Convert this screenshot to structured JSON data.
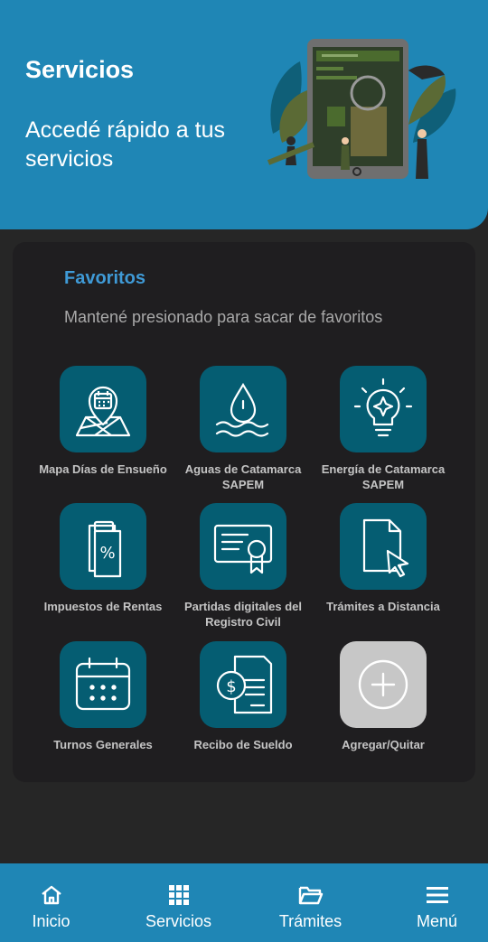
{
  "header": {
    "title": "Servicios",
    "subtitle": "Accedé rápido a tus servicios"
  },
  "favorites": {
    "title": "Favoritos",
    "hint": "Mantené presionado para sacar de favoritos",
    "items": [
      {
        "label": "Mapa Días de Ensueño",
        "icon": "map-pin-calendar-icon"
      },
      {
        "label": "Aguas de Catamarca SAPEM",
        "icon": "water-drop-icon"
      },
      {
        "label": "Energía de Catamarca SAPEM",
        "icon": "lightbulb-icon"
      },
      {
        "label": "Impuestos de Rentas",
        "icon": "percent-document-icon"
      },
      {
        "label": "Partidas digitales del Registro Civil",
        "icon": "certificate-icon"
      },
      {
        "label": "Trámites a Distancia",
        "icon": "document-cursor-icon"
      },
      {
        "label": "Turnos Generales",
        "icon": "calendar-icon"
      },
      {
        "label": "Recibo de Sueldo",
        "icon": "payslip-icon"
      },
      {
        "label": "Agregar/Quitar",
        "icon": "plus-circle-icon"
      }
    ]
  },
  "nav": {
    "items": [
      {
        "label": "Inicio",
        "icon": "home-icon"
      },
      {
        "label": "Servicios",
        "icon": "grid-icon"
      },
      {
        "label": "Trámites",
        "icon": "folder-icon"
      },
      {
        "label": "Menú",
        "icon": "hamburger-icon"
      }
    ],
    "active": "Servicios"
  },
  "colors": {
    "brand": "#1f86b5",
    "tile": "#055d72",
    "accent_title": "#3f9ad6",
    "background": "#262626"
  }
}
